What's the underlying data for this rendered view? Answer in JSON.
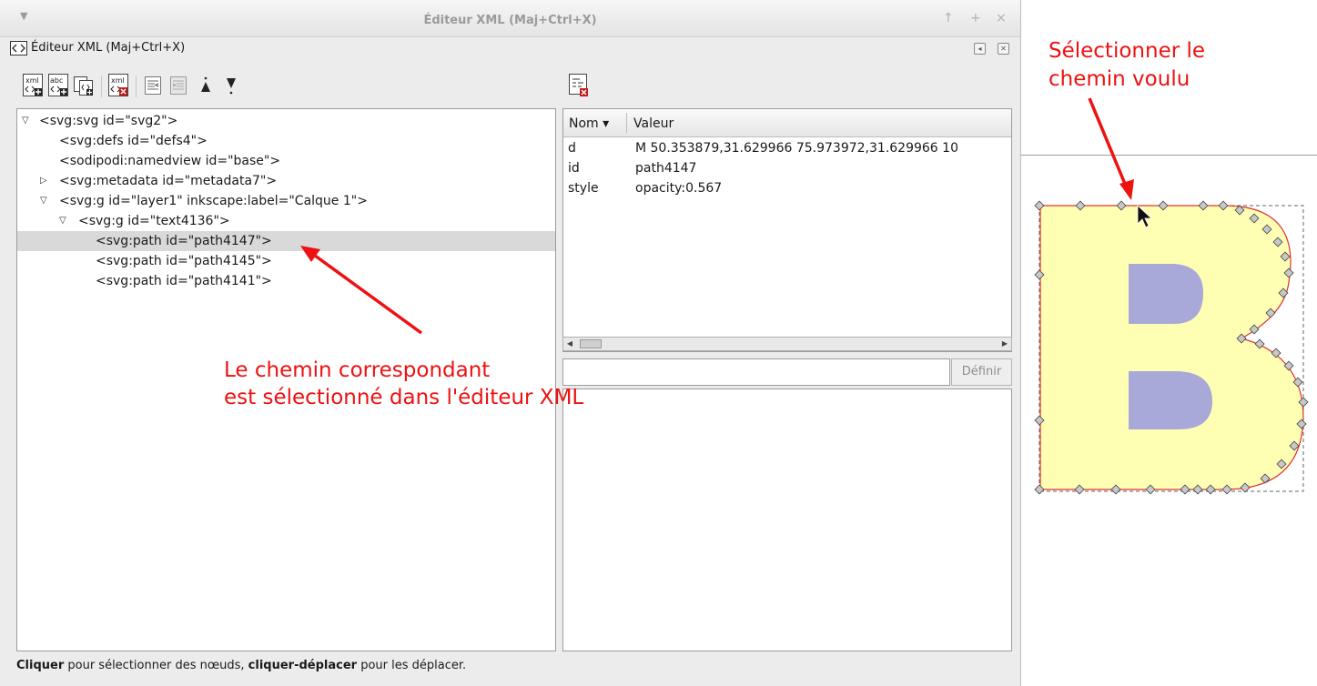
{
  "window": {
    "title": "Éditeur XML (Maj+Ctrl+X)",
    "controls": [
      "↑",
      "+",
      "×"
    ]
  },
  "dock": {
    "title": "Éditeur XML (Maj+Ctrl+X)"
  },
  "toolbar": {
    "buttons": [
      {
        "name": "new-element-node-icon",
        "label": "xml"
      },
      {
        "name": "new-text-node-icon",
        "label": "abc"
      },
      {
        "name": "duplicate-node-icon",
        "label": ""
      },
      {
        "name": "delete-node-icon",
        "label": "xml"
      },
      {
        "name": "unindent-node-icon",
        "label": ""
      },
      {
        "name": "indent-node-icon",
        "label": ""
      },
      {
        "name": "raise-node-icon",
        "label": ""
      },
      {
        "name": "lower-node-icon",
        "label": ""
      }
    ]
  },
  "tree": {
    "nodes": [
      {
        "text": "<svg:svg id=\"svg2\">",
        "expander": "▽"
      },
      {
        "text": "<svg:defs id=\"defs4\">",
        "expander": ""
      },
      {
        "text": "<sodipodi:namedview id=\"base\">",
        "expander": ""
      },
      {
        "text": "<svg:metadata id=\"metadata7\">",
        "expander": "▷"
      },
      {
        "text": "<svg:g id=\"layer1\" inkscape:label=\"Calque 1\">",
        "expander": "▽"
      },
      {
        "text": "<svg:g id=\"text4136\">",
        "expander": "▽"
      },
      {
        "text": "<svg:path id=\"path4147\">",
        "expander": ""
      },
      {
        "text": "<svg:path id=\"path4145\">",
        "expander": ""
      },
      {
        "text": "<svg:path id=\"path4141\">",
        "expander": ""
      }
    ]
  },
  "attributes": {
    "col_name": "Nom ▾",
    "col_value": "Valeur",
    "rows": [
      {
        "name": "d",
        "value": "M 50.353879,31.629966 75.973972,31.629966 10"
      },
      {
        "name": "id",
        "value": "path4147"
      },
      {
        "name": "style",
        "value": "opacity:0.567"
      }
    ]
  },
  "value_editor": {
    "set_label": "Définir",
    "value": ""
  },
  "status": {
    "bold1": "Cliquer",
    "text1": " pour sélectionner des nœuds, ",
    "bold2": "cliquer-déplacer",
    "text2": " pour les déplacer."
  },
  "annotations": {
    "left_line1": "Le chemin correspondant",
    "left_line2": "est sélectionné dans l'éditeur XML",
    "right_line1": "Sélectionner le",
    "right_line2": "chemin voulu"
  },
  "colors": {
    "annotation": "#ee1111",
    "glyph_fill": "#ffffb4",
    "counter_fill": "#a9a9d9",
    "path_outline": "#e03030"
  }
}
